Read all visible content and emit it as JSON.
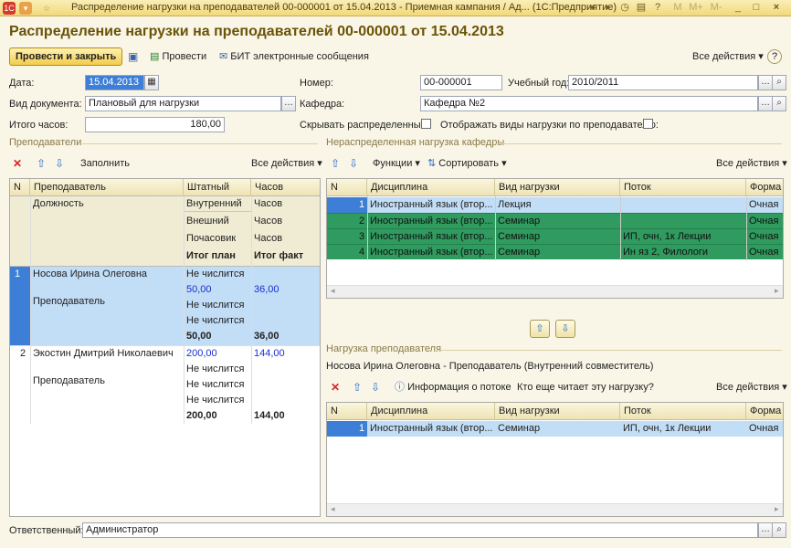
{
  "window": {
    "title": "Распределение нагрузки на преподавателей 00-000001 от 15.04.2013 - Приемная кампания / Ад...  (1С:Предприятие)",
    "app_badge": "1С"
  },
  "form": {
    "title": "Распределение нагрузки на преподавателей 00-000001 от 15.04.2013"
  },
  "toolbar": {
    "post_close": "Провести и закрыть",
    "post": "Провести",
    "bit": "БИТ электронные сообщения",
    "all_actions": "Все действия"
  },
  "header": {
    "date_label": "Дата:",
    "date_value": "15.04.2013",
    "number_label": "Номер:",
    "number_value": "00-000001",
    "year_label": "Учебный год:",
    "year_value": "2010/2011",
    "doctype_label": "Вид документа:",
    "doctype_value": "Плановый для нагрузки",
    "dept_label": "Кафедра:",
    "dept_value": "Кафедра №2",
    "total_label": "Итого часов:",
    "total_value": "180,00",
    "hide_label": "Скрывать распределенные:",
    "show_types_label": "Отображать виды нагрузки по преподавателю:"
  },
  "teachers": {
    "section": "Преподаватели",
    "fill": "Заполнить",
    "all_actions": "Все действия",
    "cols": {
      "n": "N",
      "teacher": "Преподаватель",
      "staff": "Штатный",
      "hours": "Часов"
    },
    "subhead": {
      "position": "Должность",
      "internal": "Внутренний",
      "external": "Внешний",
      "hourly": "Почасовик",
      "plan": "Итог план",
      "fact": "Итог факт",
      "hours": "Часов"
    },
    "rows": [
      {
        "n": "1",
        "name": "Носова Ирина Олеговна",
        "position": "Преподаватель",
        "staff": "Не числится",
        "internal_plan": "50,00",
        "internal_fact": "36,00",
        "external": "Не числится",
        "hourly": "Не числится",
        "plan": "50,00",
        "fact": "36,00"
      },
      {
        "n": "2",
        "name": "Экостин Дмитрий Николаевич",
        "position": "Преподаватель",
        "staff": "200,00",
        "staff_fact": "144,00",
        "internal": "Не числится",
        "external": "Не числится",
        "hourly": "Не числится",
        "plan": "200,00",
        "fact": "144,00"
      }
    ]
  },
  "unassigned": {
    "section": "Нераспределенная нагрузка кафедры",
    "functions": "Функции",
    "sort": "Сортировать",
    "all_actions": "Все действия",
    "cols": {
      "n": "N",
      "discipline": "Дисциплина",
      "type": "Вид нагрузки",
      "stream": "Поток",
      "form": "Форма"
    },
    "rows": [
      {
        "n": "1",
        "discipline": "Иностранный язык (втор...",
        "type": "Лекция",
        "stream": "",
        "form": "Очная"
      },
      {
        "n": "2",
        "discipline": "Иностранный язык (втор...",
        "type": "Семинар",
        "stream": "",
        "form": "Очная"
      },
      {
        "n": "3",
        "discipline": "Иностранный язык (втор...",
        "type": "Семинар",
        "stream": "ИП, очн, 1к Лекции",
        "form": "Очная"
      },
      {
        "n": "4",
        "discipline": "Иностранный язык (втор...",
        "type": "Семинар",
        "stream": "Ин яз 2, Филологи",
        "form": "Очная"
      }
    ]
  },
  "load": {
    "section": "Нагрузка преподавателя",
    "teacher_info": "Носова Ирина Олеговна - Преподаватель (Внутренний совместитель)",
    "info_stream": "Информация о потоке",
    "who_else": "Кто еще читает эту нагрузку?",
    "all_actions": "Все действия",
    "cols": {
      "n": "N",
      "discipline": "Дисциплина",
      "type": "Вид нагрузки",
      "stream": "Поток",
      "form": "Форма"
    },
    "rows": [
      {
        "n": "1",
        "discipline": "Иностранный язык (втор...",
        "type": "Семинар",
        "stream": "ИП, очн, 1к Лекции",
        "form": "Очная"
      }
    ]
  },
  "footer": {
    "responsible_label": "Ответственный:",
    "responsible_value": "Администратор"
  },
  "colors": {
    "accent": "#6b5306",
    "selection": "#c2ddf6",
    "green_row": "#2f9b5f",
    "blue_value": "#1a2fd0"
  }
}
